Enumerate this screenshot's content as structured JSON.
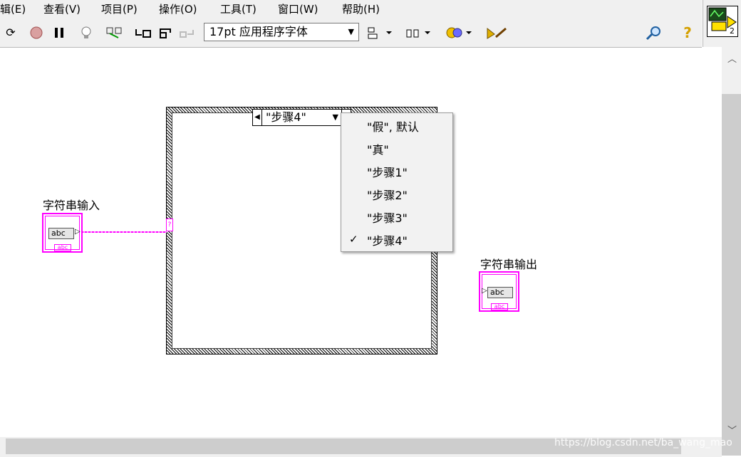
{
  "menu": [
    "辑(E)",
    "查看(V)",
    "项目(P)",
    "操作(O)",
    "工具(T)",
    "窗口(W)",
    "帮助(H)"
  ],
  "toolbar": {
    "font_value": "17pt 应用程序字体",
    "vi_icon_badge": "2"
  },
  "case_structure": {
    "selector_value": "\"步骤4\"",
    "options": [
      "\"假\", 默认",
      "\"真\"",
      "\"步骤1\"",
      "\"步骤2\"",
      "\"步骤3\"",
      "\"步骤4\""
    ],
    "checked_option": "\"步骤4\""
  },
  "input_terminal": {
    "label": "字符串输入",
    "value": "abc",
    "tag": "abc"
  },
  "output_terminal": {
    "label": "字符串输出",
    "value": "abc",
    "tag": "abc"
  },
  "tunnel_symbol": "?",
  "watermark": "https://blog.csdn.net/ba_wang_mao",
  "colors": {
    "string_wire": "#ff00ff"
  }
}
